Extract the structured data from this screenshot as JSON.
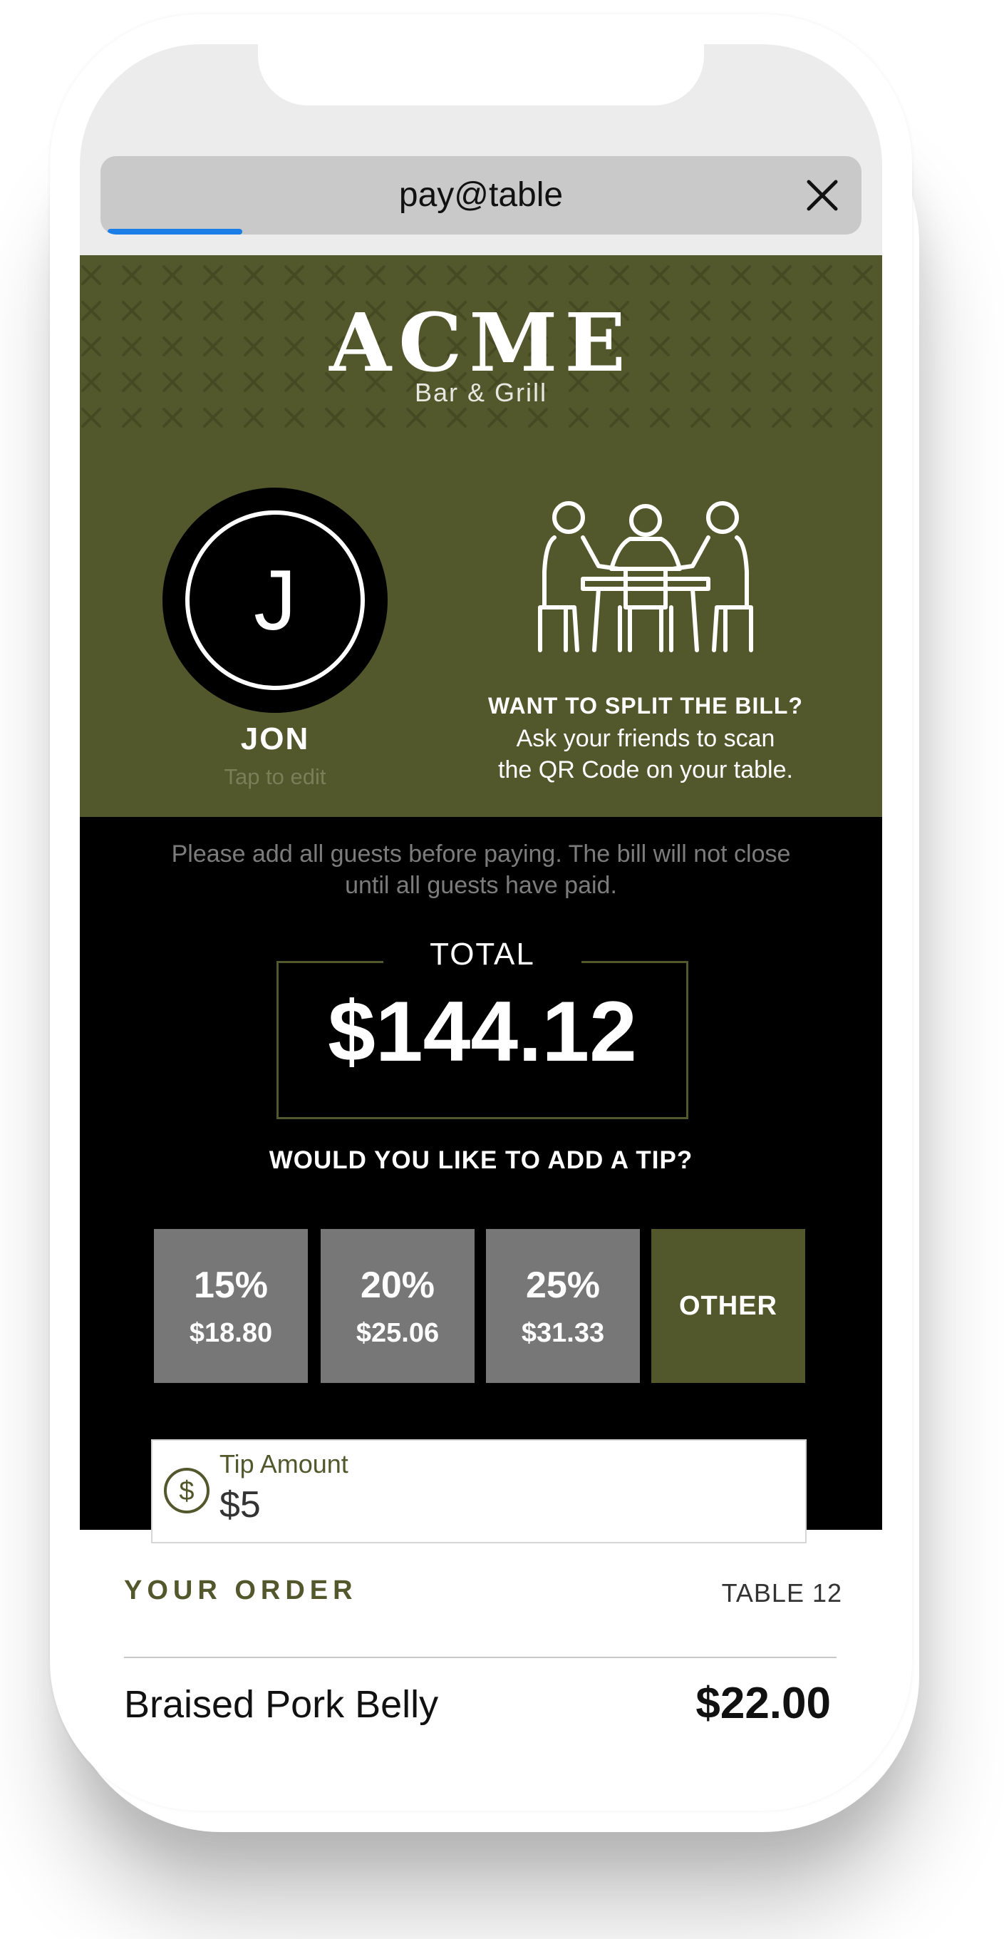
{
  "browser": {
    "url_title": "pay@table",
    "load_progress": 0.18
  },
  "restaurant": {
    "name": "ACME",
    "subtitle": "Bar & Grill"
  },
  "guest": {
    "initial": "J",
    "name": "JON",
    "edit_hint": "Tap to edit"
  },
  "split": {
    "title": "WANT TO SPLIT THE BILL?",
    "line1": "Ask your friends to scan",
    "line2": "the QR Code on your table."
  },
  "bill": {
    "notice_line1": "Please add all guests before paying. The bill will not close",
    "notice_line2": "until all guests have paid.",
    "total_label": "TOTAL",
    "total_value": "$144.12"
  },
  "tip": {
    "question": "WOULD YOU LIKE TO ADD A TIP?",
    "options": [
      {
        "percent": "15%",
        "amount": "$18.80"
      },
      {
        "percent": "20%",
        "amount": "$25.06"
      },
      {
        "percent": "25%",
        "amount": "$31.33"
      }
    ],
    "other_label": "OTHER",
    "input_label": "Tip Amount",
    "input_value": "$5"
  },
  "order": {
    "title": "YOUR ORDER",
    "table": "TABLE 12",
    "items": [
      {
        "name": "Braised Pork Belly",
        "price": "$22.00"
      }
    ]
  },
  "colors": {
    "brand_olive": "#52582c",
    "progress_blue": "#1a7ee6",
    "tip_button_gray": "#777777"
  },
  "icons": [
    "close-icon",
    "people-at-table-illustration",
    "dollar-icon",
    "fork-knife-pattern"
  ]
}
